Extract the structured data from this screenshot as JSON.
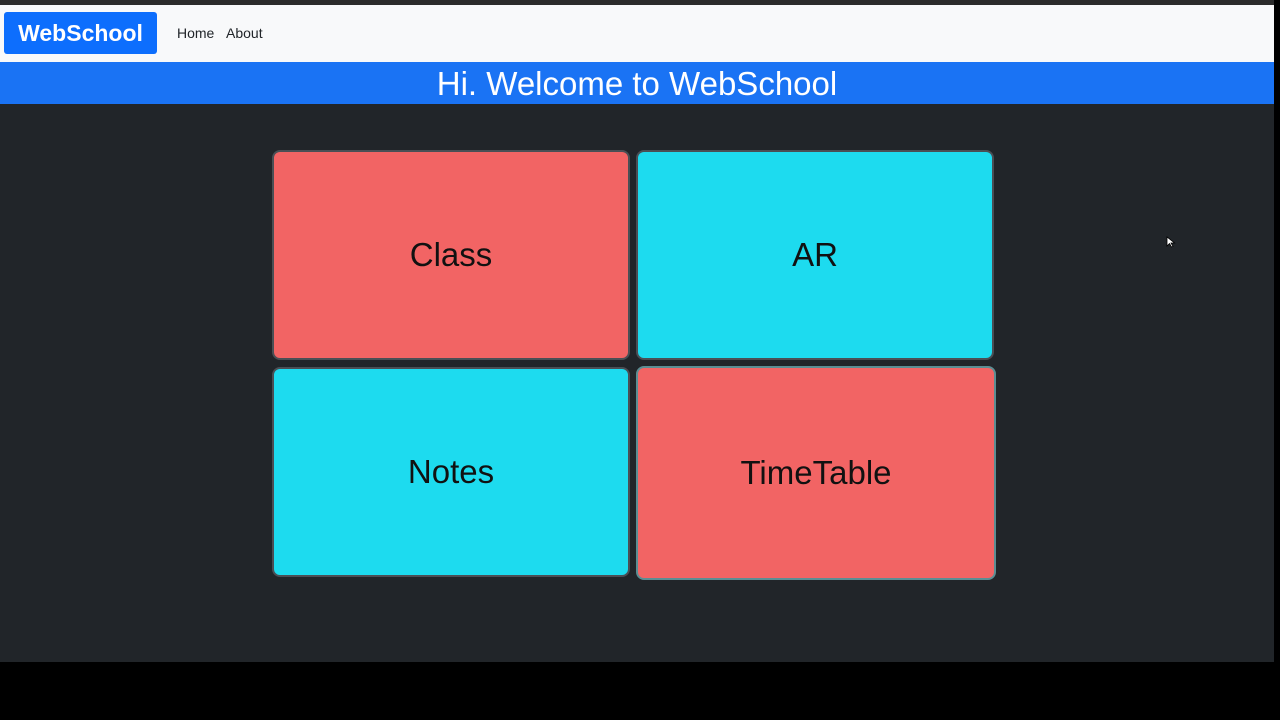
{
  "navbar": {
    "brand": "WebSchool",
    "links": [
      "Home",
      "About"
    ]
  },
  "banner": {
    "title": "Hi. Welcome to WebSchool"
  },
  "tiles": [
    {
      "label": "Class",
      "color": "#f26464"
    },
    {
      "label": "AR",
      "color": "#1ddbef"
    },
    {
      "label": "Notes",
      "color": "#1ddbef"
    },
    {
      "label": "TimeTable",
      "color": "#f26464"
    }
  ],
  "colors": {
    "page_background": "#212529",
    "navbar_background": "#f8f9fa",
    "brand_accent": "#0d6efd",
    "banner_background": "#1a73f4"
  },
  "icons": {
    "cursor": "mouse-pointer-icon"
  }
}
